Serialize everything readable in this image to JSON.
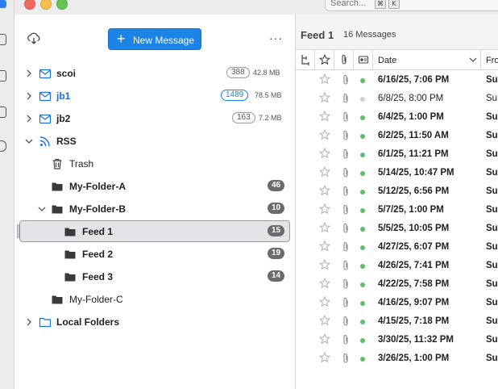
{
  "search": {
    "placeholder": "Search...",
    "key1": "⌘",
    "key2": "K"
  },
  "toolbar": {
    "new_message_label": "New Message",
    "more_label": "···"
  },
  "folders": [
    {
      "name": "scoi",
      "count": "388",
      "size": "42.8 MB",
      "icon": "mail-account-icon"
    },
    {
      "name": "jb1",
      "count": "1489",
      "size": "78.5 MB",
      "icon": "mail-account-icon"
    },
    {
      "name": "jb2",
      "count": "163",
      "size": "7.2 MB",
      "icon": "mail-account-icon"
    },
    {
      "name": "RSS",
      "icon": "rss-icon"
    },
    {
      "name": "Trash",
      "icon": "trash-icon"
    },
    {
      "name": "My-Folder-A",
      "count": "46",
      "icon": "folder-icon"
    },
    {
      "name": "My-Folder-B",
      "count": "10",
      "icon": "folder-icon"
    },
    {
      "name": "Feed 1",
      "count": "15",
      "icon": "folder-icon"
    },
    {
      "name": "Feed 2",
      "count": "19",
      "icon": "folder-icon"
    },
    {
      "name": "Feed 3",
      "count": "14",
      "icon": "folder-icon"
    },
    {
      "name": "My-Folder-C",
      "icon": "folder-icon"
    },
    {
      "name": "Local Folders",
      "icon": "folder-outline-icon"
    }
  ],
  "message_list": {
    "title": "Feed 1",
    "count_label": "16 Messages",
    "columns": {
      "date": "Date",
      "from": "Fro"
    },
    "rows": [
      {
        "date": "6/16/25, 7:06 PM",
        "from": "Su",
        "unread": true
      },
      {
        "date": "6/8/25, 8:00 PM",
        "from": "Su",
        "unread": false
      },
      {
        "date": "6/4/25, 1:00 PM",
        "from": "Su",
        "unread": true
      },
      {
        "date": "6/2/25, 11:50 AM",
        "from": "Su",
        "unread": true
      },
      {
        "date": "6/1/25, 11:21 PM",
        "from": "Su",
        "unread": true
      },
      {
        "date": "5/14/25, 10:47 PM",
        "from": "Su",
        "unread": true
      },
      {
        "date": "5/12/25, 6:56 PM",
        "from": "Su",
        "unread": true
      },
      {
        "date": "5/7/25, 1:00 PM",
        "from": "Su",
        "unread": true
      },
      {
        "date": "5/5/25, 10:05 PM",
        "from": "Su",
        "unread": true
      },
      {
        "date": "4/27/25, 6:07 PM",
        "from": "Su",
        "unread": true
      },
      {
        "date": "4/26/25, 7:41 PM",
        "from": "Su",
        "unread": true
      },
      {
        "date": "4/22/25, 7:58 PM",
        "from": "Su",
        "unread": true
      },
      {
        "date": "4/16/25, 9:07 PM",
        "from": "Su",
        "unread": true
      },
      {
        "date": "4/15/25, 7:18 PM",
        "from": "Su",
        "unread": true
      },
      {
        "date": "3/30/25, 11:32 PM",
        "from": "Su",
        "unread": true
      },
      {
        "date": "3/26/25, 1:00 PM",
        "from": "Su",
        "unread": true
      }
    ]
  },
  "colors": {
    "accent": "#1b84e6",
    "unread_dot": "#5cc06b",
    "read_dot": "#d0d0d0"
  }
}
